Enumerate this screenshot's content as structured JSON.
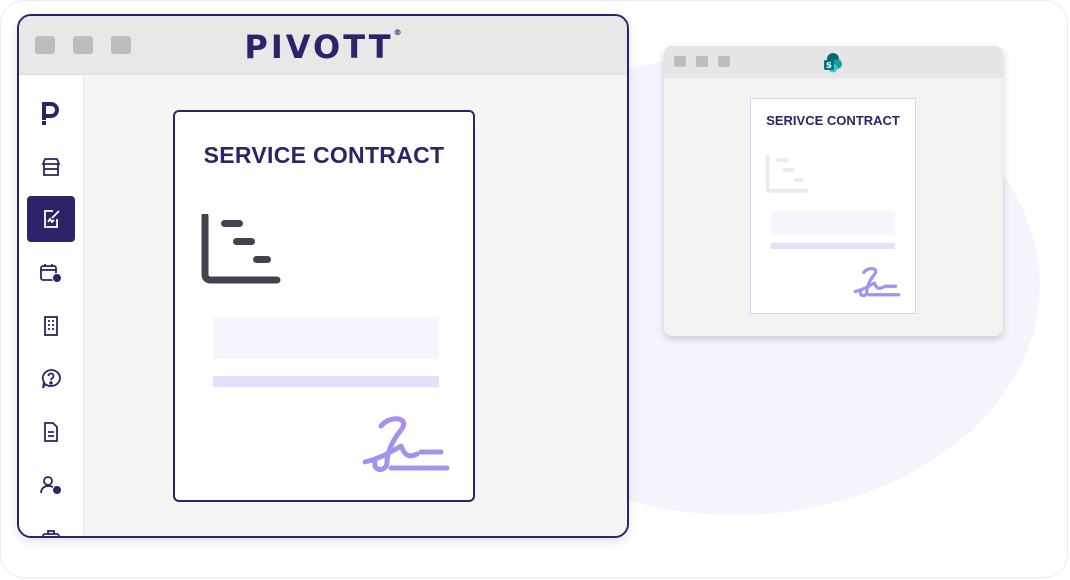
{
  "main_window": {
    "brand": "PIVOTT",
    "brand_mark": "®",
    "sidebar": {
      "items": [
        {
          "name": "pivott-logo-icon"
        },
        {
          "name": "storefront-icon"
        },
        {
          "name": "document-sign-icon",
          "active": true
        },
        {
          "name": "calendar-clock-icon"
        },
        {
          "name": "building-icon"
        },
        {
          "name": "help-bubble-icon"
        },
        {
          "name": "document-lines-icon"
        },
        {
          "name": "user-clock-icon"
        },
        {
          "name": "briefcase-icon"
        }
      ]
    },
    "document": {
      "title": "SERVICE CONTRACT"
    }
  },
  "secondary_window": {
    "app_icon": "sharepoint-icon",
    "document": {
      "title": "SERIVCE CONTRACT"
    }
  },
  "colors": {
    "brand": "#2c2369",
    "accent": "#a491f0",
    "light_bar": "#e4e0fb",
    "placeholder": "#f6f5fd"
  }
}
